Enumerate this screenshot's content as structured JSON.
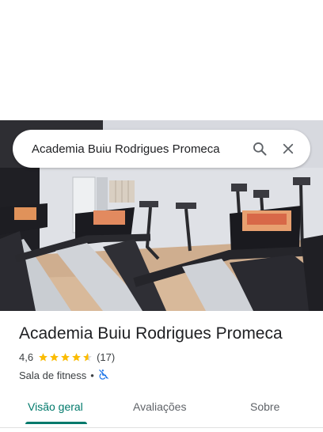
{
  "search": {
    "query": "Academia Buiu Rodrigues Promeca"
  },
  "place": {
    "name": "Academia Buiu Rodrigues Promeca",
    "rating": "4,6",
    "rating_value": 4.6,
    "review_count": "(17)",
    "category": "Sala de fitness",
    "separator": "•"
  },
  "tabs": [
    {
      "label": "Visão geral",
      "active": true
    },
    {
      "label": "Avaliações",
      "active": false
    },
    {
      "label": "Sobre",
      "active": false
    }
  ],
  "icons": {
    "search": "search-icon",
    "close": "close-icon",
    "star": "star-icon",
    "accessibility": "wheelchair-crossed-icon"
  },
  "colors": {
    "accent": "#00796b",
    "star": "#fbbc04",
    "accessibility": "#1a73e8"
  }
}
